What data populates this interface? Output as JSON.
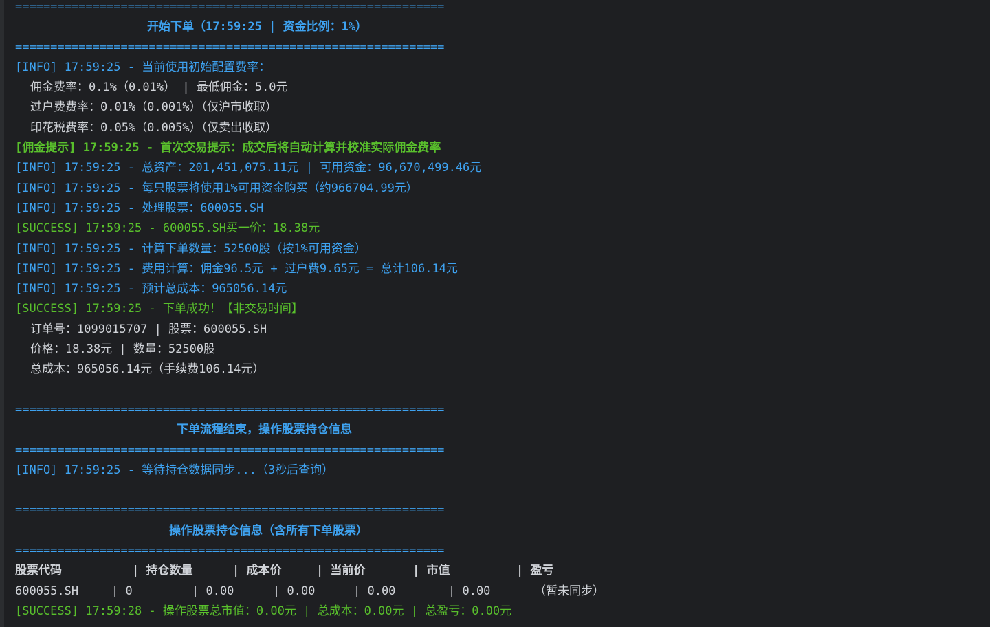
{
  "separator": "=============================================================",
  "order_header": {
    "title": "开始下单（17:59:25 | 资金比例：1%）"
  },
  "log": {
    "l1": "[INFO] 17:59:25 - 当前使用初始配置费率：",
    "l2": "佣金费率：0.1%（0.01%） | 最低佣金：5.0元",
    "l3": "过户费费率：0.01%（0.001%）（仅沪市收取）",
    "l4": "印花税费率：0.05%（0.005%）（仅卖出收取）",
    "l5": "[佣金提示] 17:59:25 - 首次交易提示：成交后将自动计算并校准实际佣金费率",
    "l6": "[INFO] 17:59:25 - 总资产：201,451,075.11元 | 可用资金：96,670,499.46元",
    "l7": "[INFO] 17:59:25 - 每只股票将使用1%可用资金购买（约966704.99元）",
    "l8": "[INFO] 17:59:25 - 处理股票：600055.SH",
    "l9": "[SUCCESS] 17:59:25 - 600055.SH买一价：18.38元",
    "l10": "[INFO] 17:59:25 - 计算下单数量：52500股（按1%可用资金）",
    "l11": "[INFO] 17:59:25 - 费用计算：佣金96.5元 + 过户费9.65元 = 总计106.14元",
    "l12": "[INFO] 17:59:25 - 预计总成本：965056.14元",
    "l13": "[SUCCESS] 17:59:25 - 下单成功！【非交易时间】",
    "l14": "订单号：1099015707 | 股票：600055.SH",
    "l15": "价格：18.38元 | 数量：52500股",
    "l16": "总成本：965056.14元（手续费106.14元）",
    "l17": "[INFO] 17:59:25 - 等待持仓数据同步...（3秒后查询）",
    "l18": "[SUCCESS] 17:59:28 - 操作股票总市值：0.00元 | 总成本：0.00元 | 总盈亏：0.00元"
  },
  "order_end_header": {
    "title": "下单流程结束，操作股票持仓信息"
  },
  "position_header": {
    "title": "操作股票持仓信息（含所有下单股票）"
  },
  "table": {
    "headers": [
      "股票代码",
      "| 持仓数量",
      "| 成本价",
      "| 当前价",
      "| 市值",
      "| 盈亏"
    ],
    "row": [
      "600055.SH",
      "| 0",
      "| 0.00",
      "| 0.00",
      "| 0.00",
      "| 0.00",
      "（暂未同步）"
    ]
  },
  "colors": {
    "info": "#3ea2f0",
    "success": "#59c02c",
    "text": "#d0d3d8",
    "background": "#1e1f22"
  }
}
